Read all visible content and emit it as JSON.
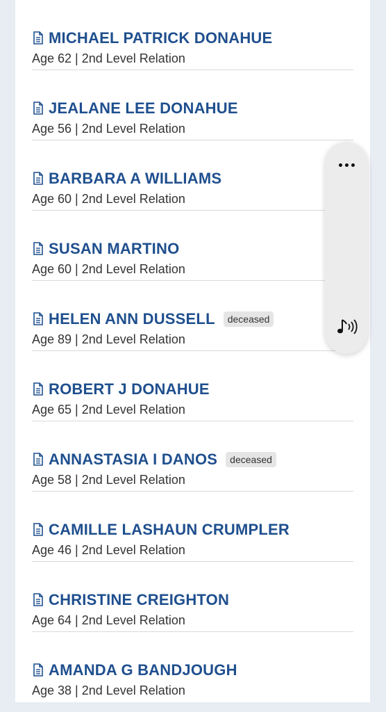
{
  "results": [
    {
      "name": "MICHAEL PATRICK DONAHUE",
      "meta": "Age 62 | 2nd Level Relation",
      "badge": ""
    },
    {
      "name": "JEALANE LEE DONAHUE",
      "meta": "Age 56 | 2nd Level Relation",
      "badge": ""
    },
    {
      "name": "BARBARA A WILLIAMS",
      "meta": "Age 60 | 2nd Level Relation",
      "badge": ""
    },
    {
      "name": "SUSAN MARTINO",
      "meta": "Age 60 | 2nd Level Relation",
      "badge": ""
    },
    {
      "name": "HELEN ANN DUSSELL",
      "meta": "Age 89 | 2nd Level Relation",
      "badge": "deceased"
    },
    {
      "name": "ROBERT J DONAHUE",
      "meta": "Age 65 | 2nd Level Relation",
      "badge": ""
    },
    {
      "name": "ANNASTASIA I DANOS",
      "meta": "Age 58 | 2nd Level Relation",
      "badge": "deceased"
    },
    {
      "name": "CAMILLE LASHAUN CRUMPLER",
      "meta": "Age 46 | 2nd Level Relation",
      "badge": ""
    },
    {
      "name": "CHRISTINE CREIGHTON",
      "meta": "Age 64 | 2nd Level Relation",
      "badge": ""
    },
    {
      "name": "AMANDA G BANDJOUGH",
      "meta": "Age 38 | 2nd Level Relation",
      "badge": ""
    }
  ],
  "icons": {
    "document": "document-icon",
    "more": "more-icon",
    "audio": "audio-icon"
  },
  "colors": {
    "name": "#1f4f8e",
    "page_bg": "#e8ecf3",
    "card_bg": "#ffffff",
    "panel_bg": "#ececec",
    "badge_bg": "#e5e5e5"
  }
}
